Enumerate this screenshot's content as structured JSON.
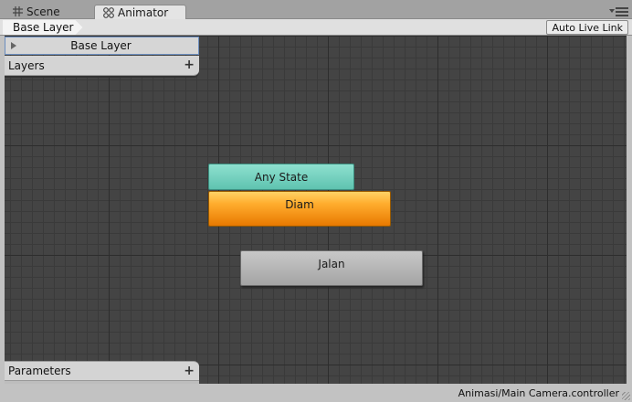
{
  "tabs": [
    {
      "label": "Scene",
      "icon": "grid-icon",
      "active": false
    },
    {
      "label": "Animator",
      "icon": "animator-icon",
      "active": true
    }
  ],
  "breadcrumb": {
    "label": "Base Layer"
  },
  "toolbar": {
    "auto_live_link": "Auto Live Link"
  },
  "layers": {
    "header": "Layers",
    "items": [
      {
        "name": "Base Layer",
        "selected": true
      }
    ]
  },
  "parameters": {
    "header": "Parameters"
  },
  "states": [
    {
      "name": "Any State",
      "color": "#6fd1bf"
    },
    {
      "name": "Diam",
      "color": "#f59a1a",
      "default": true
    },
    {
      "name": "Jalan",
      "color": "#b5b5b5"
    }
  ],
  "status": {
    "controller_path": "Animasi/Main Camera.controller"
  },
  "colors": {
    "graph_bg": "#444444",
    "selection_border": "#6c8ebf"
  }
}
